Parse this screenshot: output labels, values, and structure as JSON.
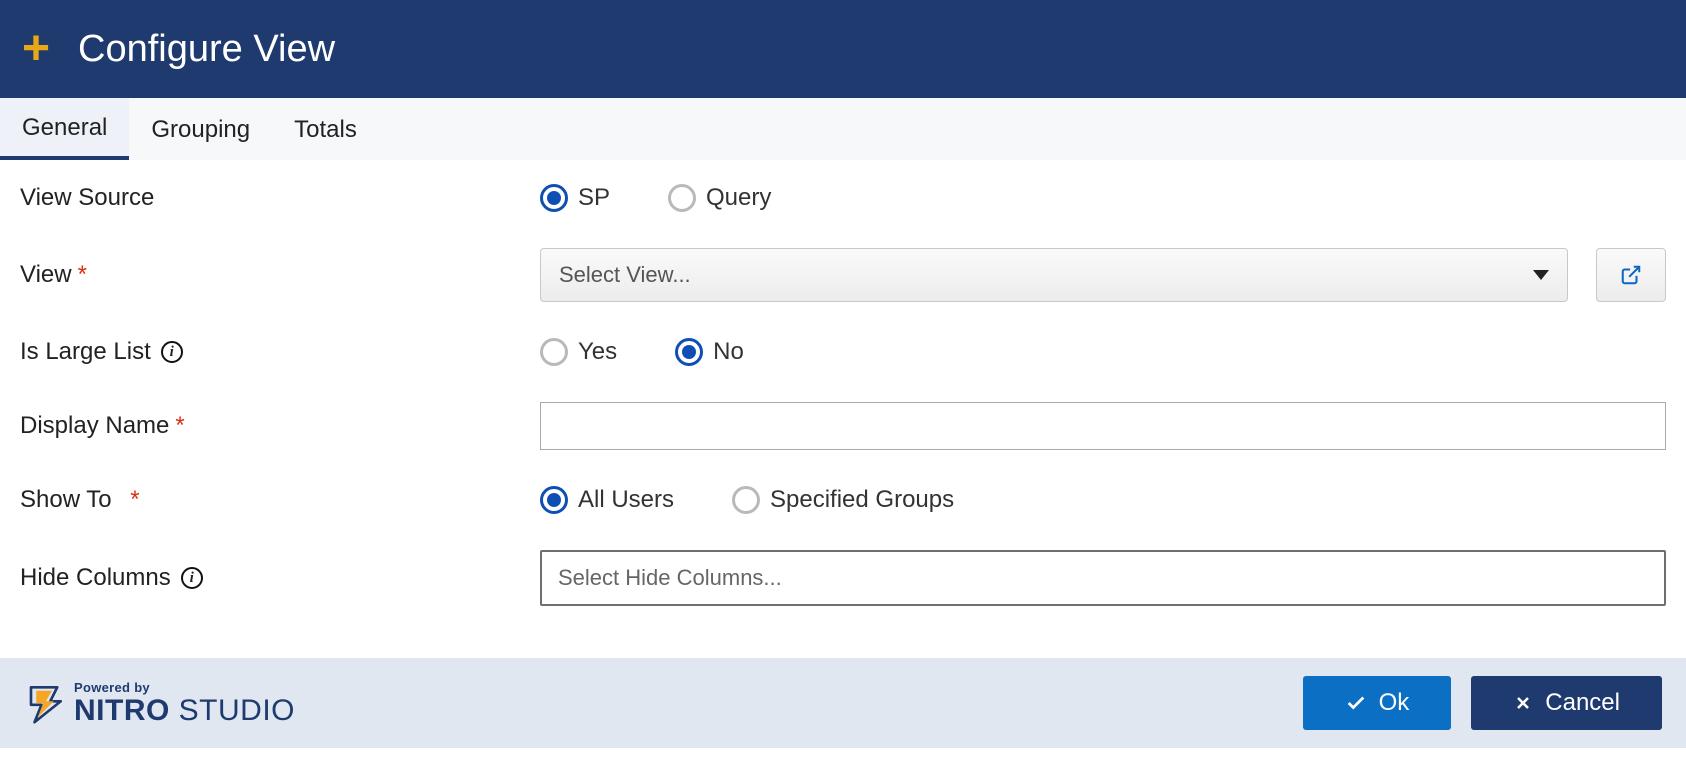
{
  "header": {
    "title": "Configure View",
    "add_icon": "plus-icon"
  },
  "tabs": [
    {
      "id": "general",
      "label": "General",
      "active": true
    },
    {
      "id": "grouping",
      "label": "Grouping",
      "active": false
    },
    {
      "id": "totals",
      "label": "Totals",
      "active": false
    }
  ],
  "form": {
    "view_source": {
      "label": "View Source",
      "options": {
        "sp": "SP",
        "query": "Query"
      },
      "selected": "sp"
    },
    "view": {
      "label": "View",
      "required": true,
      "placeholder": "Select View...",
      "value": "",
      "external_icon": "external-link-icon"
    },
    "is_large_list": {
      "label": "Is Large List",
      "info": true,
      "options": {
        "yes": "Yes",
        "no": "No"
      },
      "selected": "no"
    },
    "display_name": {
      "label": "Display Name",
      "required": true,
      "value": ""
    },
    "show_to": {
      "label": "Show To",
      "required": true,
      "options": {
        "all": "All Users",
        "groups": "Specified Groups"
      },
      "selected": "all"
    },
    "hide_columns": {
      "label": "Hide Columns",
      "info": true,
      "placeholder": "Select Hide Columns..."
    }
  },
  "footer": {
    "brand_powered": "Powered by",
    "brand_name_bold": "NITRO",
    "brand_name_light": " STUDIO",
    "ok_label": "Ok",
    "cancel_label": "Cancel"
  }
}
